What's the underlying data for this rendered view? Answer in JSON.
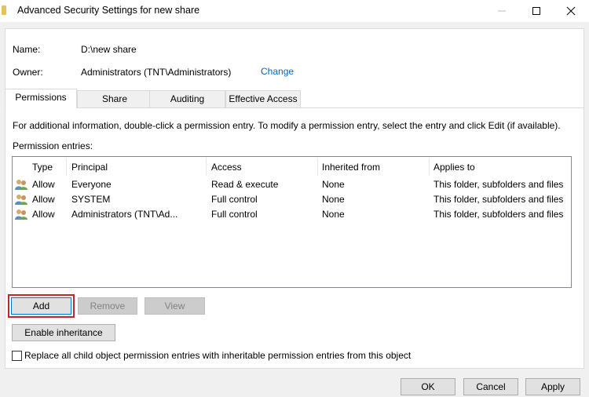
{
  "window": {
    "title": "Advanced Security Settings for new share"
  },
  "info": {
    "name_label": "Name:",
    "name_value": "D:\\new share",
    "owner_label": "Owner:",
    "owner_value": "Administrators (TNT\\Administrators)",
    "change_link": "Change"
  },
  "tabs": [
    {
      "label": "Permissions",
      "active": true
    },
    {
      "label": "Share",
      "active": false
    },
    {
      "label": "Auditing",
      "active": false
    },
    {
      "label": "Effective Access",
      "active": false
    }
  ],
  "permissions": {
    "info_text": "For additional information, double-click a permission entry. To modify a permission entry, select the entry and click Edit (if available).",
    "entries_label": "Permission entries:",
    "columns": [
      "Type",
      "Principal",
      "Access",
      "Inherited from",
      "Applies to"
    ],
    "rows": [
      {
        "icon": "users-icon",
        "type": "Allow",
        "principal": "Everyone",
        "access": "Read & execute",
        "inherited": "None",
        "applies": "This folder, subfolders and files"
      },
      {
        "icon": "users-icon",
        "type": "Allow",
        "principal": "SYSTEM",
        "access": "Full control",
        "inherited": "None",
        "applies": "This folder, subfolders and files"
      },
      {
        "icon": "users-icon",
        "type": "Allow",
        "principal": "Administrators (TNT\\Ad...",
        "access": "Full control",
        "inherited": "None",
        "applies": "This folder, subfolders and files"
      }
    ]
  },
  "buttons": {
    "add": "Add",
    "remove": "Remove",
    "view": "View",
    "enable_inheritance": "Enable inheritance",
    "replace_checkbox_label": "Replace all child object permission entries with inheritable permission entries from this object",
    "ok": "OK",
    "cancel": "Cancel",
    "apply": "Apply"
  },
  "colors": {
    "link": "#0066cc",
    "highlight": "#c0262d"
  }
}
